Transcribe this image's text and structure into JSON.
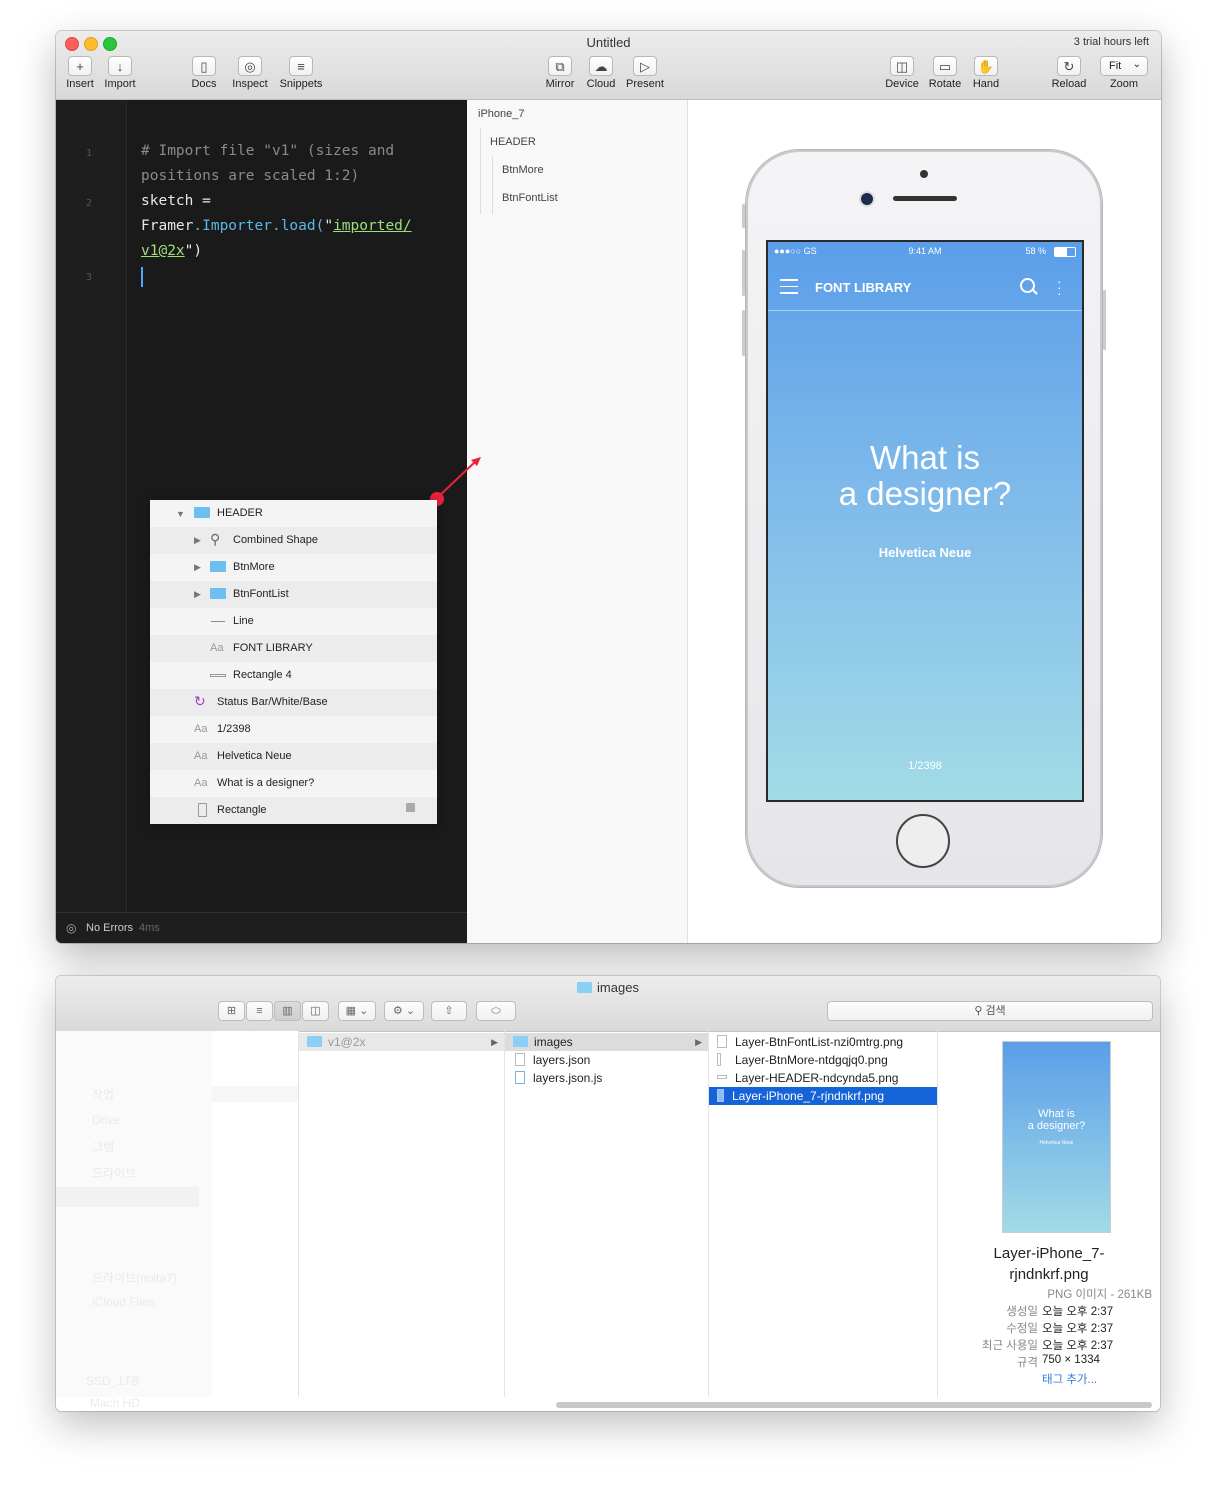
{
  "framer": {
    "title": "Untitled",
    "trial": "3 trial hours left",
    "toolbar": {
      "insert": "Insert",
      "import": "Import",
      "docs": "Docs",
      "inspect": "Inspect",
      "snippets": "Snippets",
      "mirror": "Mirror",
      "cloud": "Cloud",
      "present": "Present",
      "device": "Device",
      "rotate": "Rotate",
      "hand": "Hand",
      "reload": "Reload",
      "zoom": "Zoom",
      "zoom_value": "Fit"
    },
    "code": {
      "line_numbers": [
        "1",
        "2",
        "3"
      ],
      "line1a": "# Import file \"v1\" (sizes and",
      "line1b": "positions are scaled 1:2)",
      "line2a": "sketch =",
      "line2_obj": "Framer",
      "line2_call": ".Importer.load(",
      "line2_q": "\"",
      "line2_str1": "imported/",
      "line2_str2": "v1@2x",
      "line2_end": "\")"
    },
    "status": {
      "label": "No Errors",
      "time": "4ms"
    },
    "layers": [
      "iPhone_7",
      "HEADER",
      "BtnMore",
      "BtnFontList"
    ],
    "phone": {
      "status_left": "●●●○○ GS",
      "status_time": "9:41 AM",
      "status_right": "58 %",
      "header_title": "FONT LIBRARY",
      "headline1": "What is",
      "headline2": "a designer?",
      "font_name": "Helvetica Neue",
      "counter": "1/2398"
    },
    "overlay_rows": [
      {
        "label": "HEADER"
      },
      {
        "label": "Combined Shape"
      },
      {
        "label": "BtnMore"
      },
      {
        "label": "BtnFontList"
      },
      {
        "label": "Line"
      },
      {
        "label": "FONT LIBRARY",
        "icon_text": "Aa"
      },
      {
        "label": "Rectangle 4"
      },
      {
        "label": "Status Bar/White/Base"
      },
      {
        "label": "1/2398",
        "icon_text": "Aa"
      },
      {
        "label": "Helvetica Neue",
        "icon_text": "Aa"
      },
      {
        "label": "What is a designer?",
        "icon_text": "Aa"
      },
      {
        "label": "Rectangle"
      }
    ],
    "accent_color": "#e8223a"
  },
  "finder": {
    "title": "images",
    "search_placeholder": "검색",
    "sidebar_faded": [
      "작업",
      "Drive",
      "그램",
      "드라이브",
      "드라이브(nolta7)",
      "iCloud Files",
      "SSD_1TB",
      "Mach HD"
    ],
    "col1": [
      "v1@2x"
    ],
    "col2": [
      "images",
      "layers.json",
      "layers.json.js"
    ],
    "col3": [
      "Layer-BtnFontList-nzi0mtrg.png",
      "Layer-BtnMore-ntdgqjq0.png",
      "Layer-HEADER-ndcynda5.png",
      "Layer-iPhone_7-rjndnkrf.png"
    ],
    "preview": {
      "thumb_line1": "What is",
      "thumb_line2": "a designer?",
      "thumb_font": "Helvetica Neue",
      "name1": "Layer-iPhone_7-",
      "name2": "rjndnkrf.png",
      "kind": "PNG 이미지 - 261KB",
      "created_label": "생성일",
      "created": "오늘 오후 2:37",
      "modified_label": "수정일",
      "modified": "오늘 오후 2:37",
      "opened_label": "최근 사용일",
      "opened": "오늘 오후 2:37",
      "size_label": "규격",
      "size": "750 × 1334",
      "tags": "태그 추가..."
    }
  }
}
